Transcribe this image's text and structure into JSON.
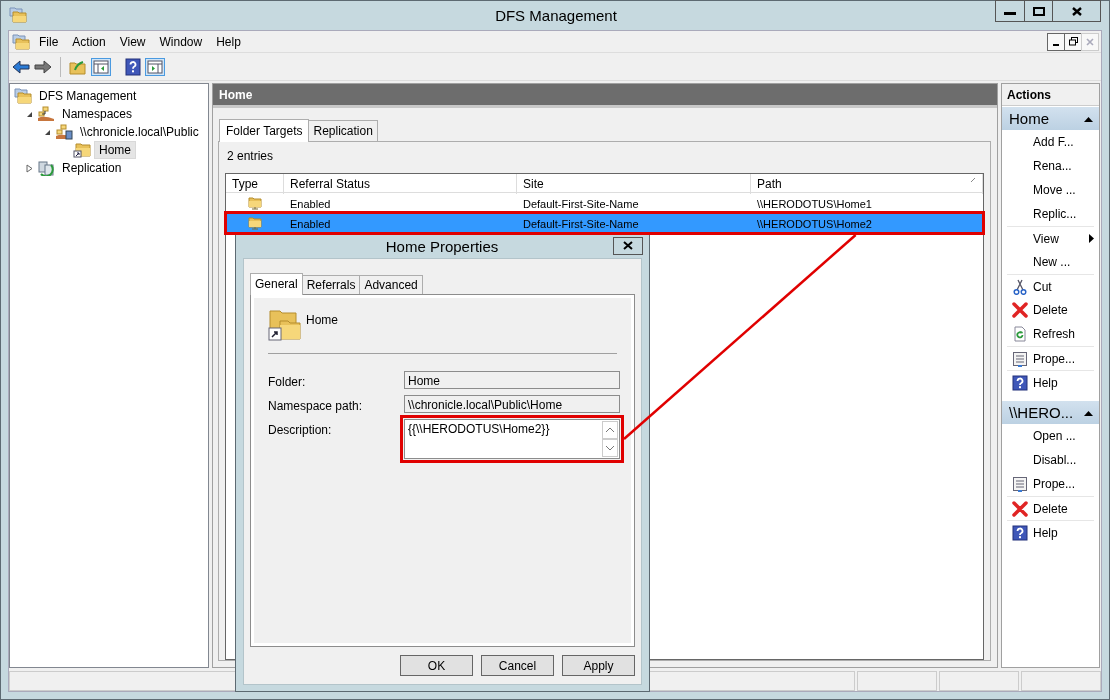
{
  "window": {
    "title": "DFS Management"
  },
  "menu": [
    "File",
    "Action",
    "View",
    "Window",
    "Help"
  ],
  "toolbar": [
    {
      "kind": "back",
      "disabled": false
    },
    {
      "kind": "forward",
      "disabled": true
    },
    {
      "kind": "up",
      "disabled": false
    },
    {
      "kind": "show-tree",
      "disabled": false
    },
    {
      "kind": "help",
      "disabled": false
    },
    {
      "kind": "show-actions",
      "disabled": false
    }
  ],
  "tree": [
    {
      "label": "DFS Management",
      "kind": "root",
      "selected": false,
      "children": [
        {
          "label": "Namespaces",
          "kind": "namespaces",
          "expanded": true,
          "selected": false,
          "children": [
            {
              "label": "\\\\chronicle.local\\Public",
              "kind": "namespace",
              "expanded": true,
              "selected": false,
              "children": [
                {
                  "label": "Home",
                  "kind": "folder",
                  "selected": true
                }
              ]
            }
          ]
        },
        {
          "label": "Replication",
          "kind": "replication",
          "expanded": false,
          "selected": false
        }
      ]
    }
  ],
  "panel": {
    "title": "Home",
    "tabs": [
      {
        "label": "Folder Targets",
        "selected": true
      },
      {
        "label": "Replication",
        "selected": false
      }
    ],
    "count": "2 entries",
    "columns": [
      "Type",
      "Referral Status",
      "Site",
      "Path"
    ],
    "rows": [
      {
        "status": "Enabled",
        "site": "Default-First-Site-Name",
        "path": "\\\\HERODOTUS\\Home1",
        "selected": false
      },
      {
        "status": "Enabled",
        "site": "Default-First-Site-Name",
        "path": "\\\\HERODOTUS\\Home2",
        "selected": true
      }
    ]
  },
  "actions": {
    "title": "Actions",
    "groups": [
      {
        "title": "Home",
        "items": [
          {
            "label": "Add F...",
            "kind": "none",
            "divider": false,
            "submenu": false
          },
          {
            "label": "Rena...",
            "kind": "none",
            "divider": false,
            "submenu": false
          },
          {
            "label": "Move ...",
            "kind": "none",
            "divider": false,
            "submenu": false
          },
          {
            "label": "Replic...",
            "kind": "none",
            "divider": false,
            "submenu": false
          },
          {
            "label": "View",
            "kind": "none",
            "divider": true,
            "submenu": true
          },
          {
            "label": "New ...",
            "kind": "none",
            "divider": false,
            "submenu": false
          },
          {
            "label": "Cut",
            "kind": "cut",
            "divider": true,
            "submenu": false
          },
          {
            "label": "Delete",
            "kind": "delete",
            "divider": false,
            "submenu": false
          },
          {
            "label": "Refresh",
            "kind": "refresh",
            "divider": false,
            "submenu": false
          },
          {
            "label": "Prope...",
            "kind": "properties",
            "divider": true,
            "submenu": false
          },
          {
            "label": "Help",
            "kind": "help",
            "divider": true,
            "submenu": false
          }
        ]
      },
      {
        "title": "\\\\HERO...",
        "items": [
          {
            "label": "Open ...",
            "kind": "none",
            "divider": false,
            "submenu": false
          },
          {
            "label": "Disabl...",
            "kind": "none",
            "divider": false,
            "submenu": false
          },
          {
            "label": "Prope...",
            "kind": "properties",
            "divider": false,
            "submenu": false
          },
          {
            "label": "Delete",
            "kind": "delete",
            "divider": true,
            "submenu": false
          },
          {
            "label": "Help",
            "kind": "help",
            "divider": true,
            "submenu": false
          }
        ]
      }
    ]
  },
  "dialog": {
    "title": "Home Properties",
    "tabs": [
      {
        "label": "General",
        "selected": true
      },
      {
        "label": "Referrals",
        "selected": false
      },
      {
        "label": "Advanced",
        "selected": false
      }
    ],
    "header": "Home",
    "fields": [
      {
        "label": "Folder:",
        "value": "Home",
        "kind": "line"
      },
      {
        "label": "Namespace path:",
        "value": "\\\\chronicle.local\\Public\\Home",
        "kind": "line"
      },
      {
        "label": "Description:",
        "value": "{{\\\\HERODOTUS\\Home2}}",
        "kind": "multiline"
      }
    ],
    "buttons": [
      "OK",
      "Cancel",
      "Apply"
    ]
  }
}
